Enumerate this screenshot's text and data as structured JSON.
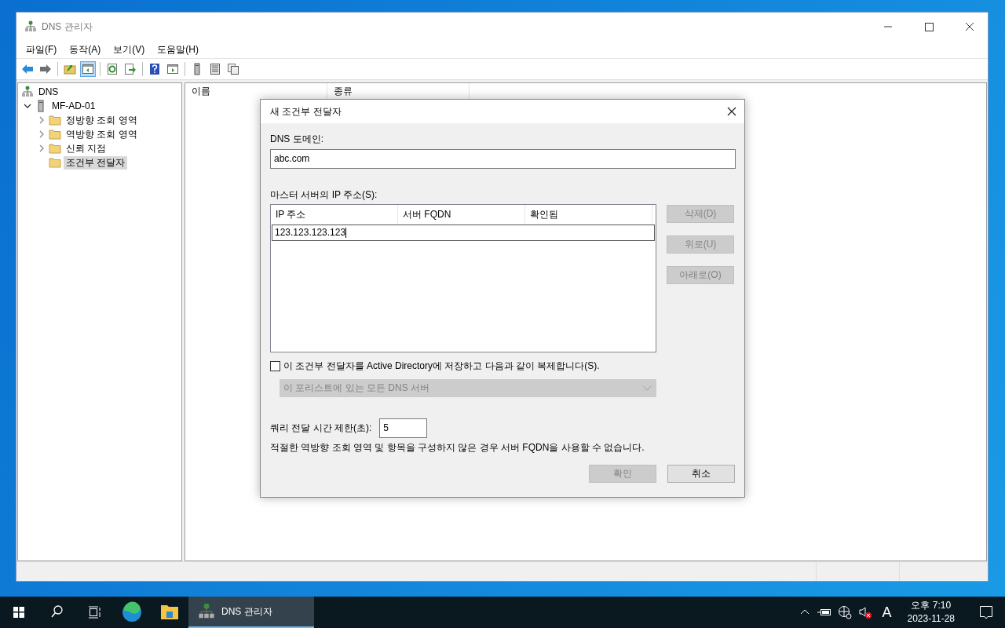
{
  "window": {
    "title": "DNS 관리자"
  },
  "menu": [
    "파일(F)",
    "동작(A)",
    "보기(V)",
    "도움말(H)"
  ],
  "toolbar": [
    [
      {
        "kind": "back",
        "selected": false
      },
      {
        "kind": "forward",
        "selected": false
      }
    ],
    [
      {
        "kind": "upfolder",
        "selected": false
      },
      {
        "kind": "console",
        "selected": true
      }
    ],
    [
      {
        "kind": "refresh",
        "selected": false
      },
      {
        "kind": "export",
        "selected": false
      }
    ],
    [
      {
        "kind": "help",
        "selected": false
      },
      {
        "kind": "pane",
        "selected": false
      }
    ],
    [
      {
        "kind": "server",
        "selected": false
      },
      {
        "kind": "list",
        "selected": false
      },
      {
        "kind": "copy",
        "selected": false
      }
    ]
  ],
  "tree": [
    {
      "label": "DNS",
      "kind": "dns",
      "selected": false,
      "children": [
        {
          "label": "MF-AD-01",
          "kind": "server",
          "expandable": true,
          "expanded": true,
          "selected": false,
          "children": [
            {
              "label": "정방향 조회 영역",
              "kind": "folder",
              "expandable": true,
              "expanded": false,
              "selected": false
            },
            {
              "label": "역방향 조회 영역",
              "kind": "folder",
              "expandable": true,
              "expanded": false,
              "selected": false
            },
            {
              "label": "신뢰 지점",
              "kind": "folder",
              "expandable": true,
              "expanded": false,
              "selected": false
            },
            {
              "label": "조건부 전달자",
              "kind": "folder",
              "expandable": false,
              "expanded": false,
              "selected": true
            }
          ]
        }
      ]
    }
  ],
  "list": {
    "columns": [
      "이름",
      "종류"
    ]
  },
  "dialog": {
    "title": "새 조건부 전달자",
    "domain_label": "DNS 도메인:",
    "domain_value": "abc.com",
    "master_label": "마스터 서버의 IP 주소(S):",
    "table": {
      "columns": [
        "IP 주소",
        "서버 FQDN",
        "확인됨"
      ],
      "rows": [
        {
          "ip": "123.123.123.123",
          "editing": true
        }
      ]
    },
    "side_buttons": [
      {
        "label": "삭제(D)",
        "disabled": true
      },
      {
        "label": "위로(U)",
        "disabled": true
      },
      {
        "label": "아래로(O)",
        "disabled": true
      }
    ],
    "replicate": {
      "label": "이 조건부 전달자를 Active Directory에 저장하고 다음과 같이 복제합니다(S).",
      "checked": false
    },
    "scope": {
      "value": "이 포리스트에 있는 모든 DNS 서버",
      "disabled": true
    },
    "timeout": {
      "label": "쿼리 전달 시간 제한(초):",
      "value": "5"
    },
    "note": "적절한 역방향 조회 영역 및 항목을 구성하지 않은 경우 서버 FQDN을 사용할 수 없습니다.",
    "buttons": [
      {
        "label": "확인",
        "disabled": true
      },
      {
        "label": "취소",
        "disabled": false
      }
    ]
  },
  "taskbar": {
    "apps": [
      {
        "label": "DNS 관리자",
        "selected": true
      }
    ],
    "ime": "A",
    "time": "오후 7:10",
    "date": "2023-11-28"
  }
}
